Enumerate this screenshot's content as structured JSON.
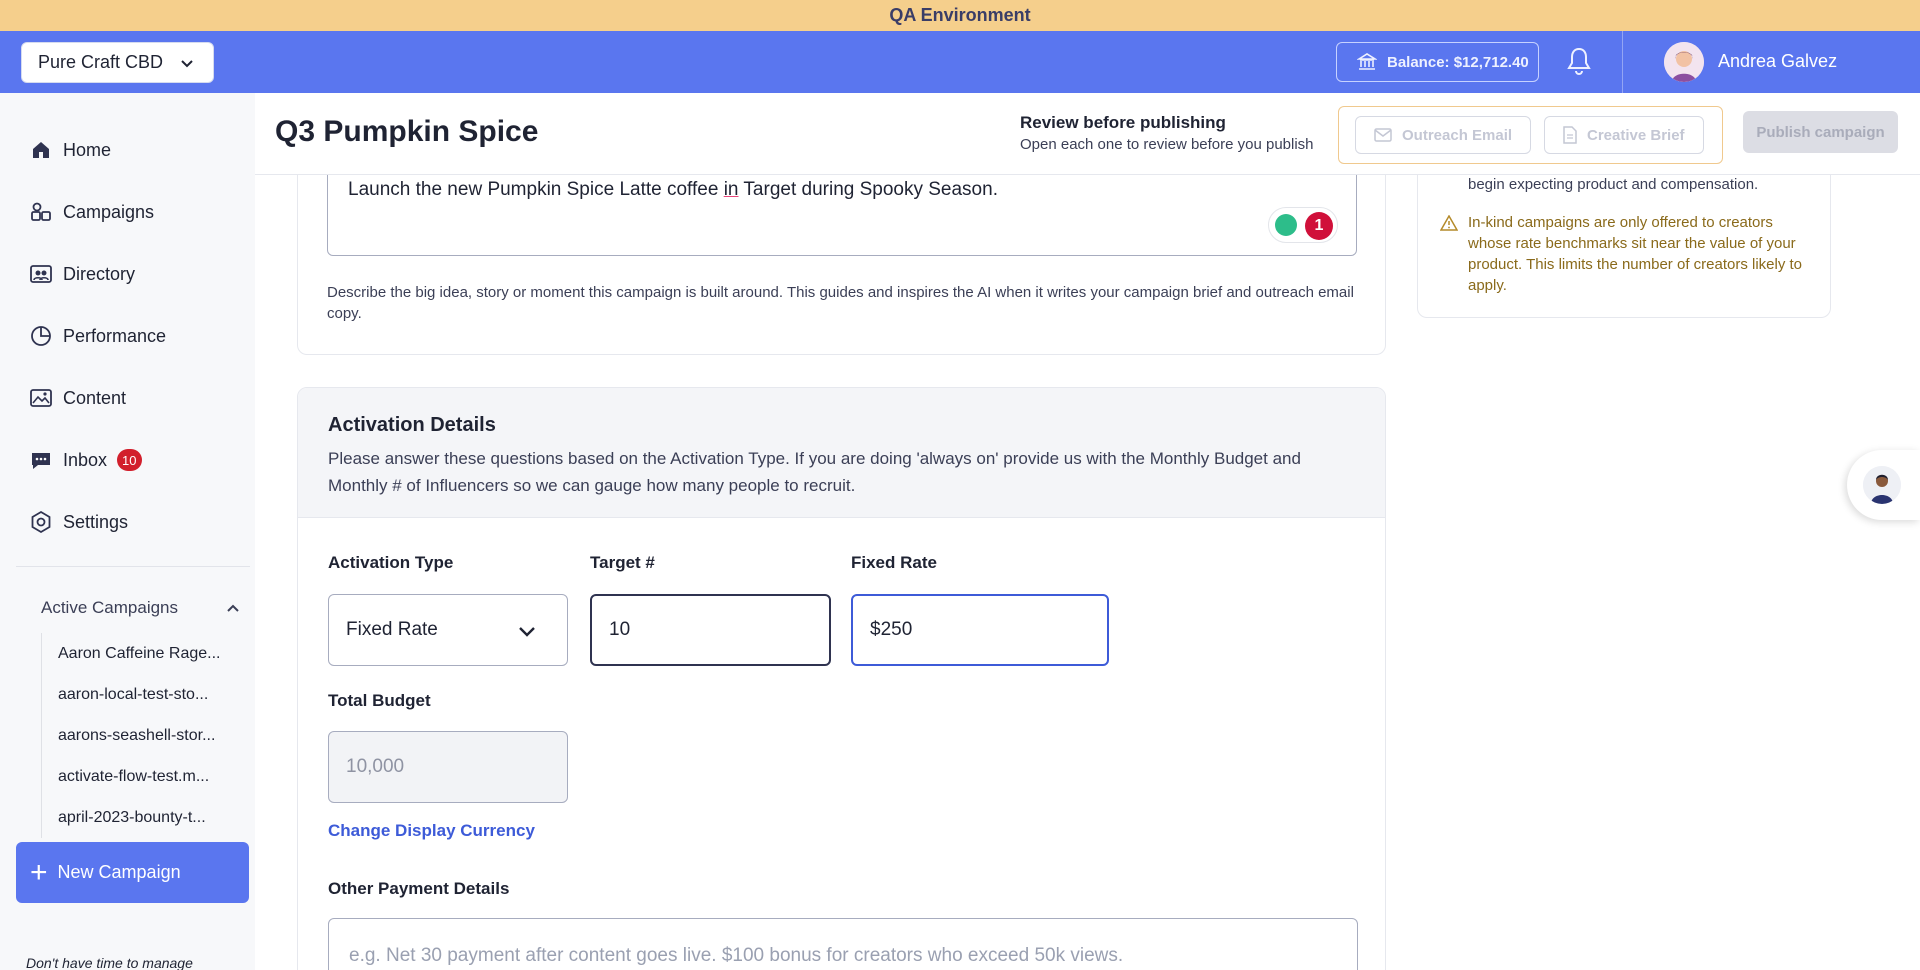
{
  "qa_banner": "QA Environment",
  "topbar": {
    "brand": "Pure Craft CBD",
    "balance": "Balance: $12,712.40",
    "user_name": "Andrea Galvez"
  },
  "sidebar": {
    "items": [
      {
        "label": "Home",
        "icon": "home-icon"
      },
      {
        "label": "Campaigns",
        "icon": "campaigns-icon"
      },
      {
        "label": "Directory",
        "icon": "directory-icon"
      },
      {
        "label": "Performance",
        "icon": "performance-icon"
      },
      {
        "label": "Content",
        "icon": "content-icon"
      },
      {
        "label": "Inbox",
        "icon": "inbox-icon",
        "badge": "10"
      },
      {
        "label": "Settings",
        "icon": "settings-icon"
      }
    ],
    "active_campaigns_label": "Active Campaigns",
    "campaigns": [
      "Aaron Caffeine Rage...",
      "aaron-local-test-sto...",
      "aarons-seashell-stor...",
      "activate-flow-test.m...",
      "april-2023-bounty-t..."
    ],
    "new_campaign_label": "New Campaign",
    "footer_text": "Don't have time to manage"
  },
  "header": {
    "title": "Q3 Pumpkin Spice",
    "review_title": "Review before publishing",
    "review_subtitle": "Open each one to review before you publish",
    "outreach_email_label": "Outreach Email",
    "creative_brief_label": "Creative Brief",
    "publish_label": "Publish campaign"
  },
  "concept": {
    "text_before": "Launch the new Pumpkin Spice Latte coffee ",
    "text_underlined": "in",
    "text_after": " Target during Spooky Season.",
    "grammar_count": "1",
    "description": "Describe the big idea, story or moment this campaign is built around. This guides and inspires the AI when it writes your campaign brief and outreach email copy."
  },
  "right_panel": {
    "line1": "begin expecting product and compensation.",
    "warning": "In-kind campaigns are only offered to creators whose rate benchmarks sit near the value of your product. This limits the number of creators likely to apply."
  },
  "activation": {
    "title": "Activation Details",
    "description": "Please answer these questions based on the Activation Type. If you are doing 'always on' provide us with the Monthly Budget and Monthly # of Influencers so we can gauge how many people to recruit.",
    "activation_type_label": "Activation Type",
    "activation_type_value": "Fixed Rate",
    "target_label": "Target #",
    "target_value": "10",
    "fixed_rate_label": "Fixed Rate",
    "fixed_rate_value": "$250",
    "total_budget_label": "Total Budget",
    "total_budget_value": "10,000",
    "change_currency_label": "Change Display Currency",
    "other_payment_label": "Other Payment Details",
    "other_payment_placeholder": "e.g. Net 30 payment after content goes live. $100 bonus for creators who exceed 50k views."
  },
  "colors": {
    "primary": "#5a76ef",
    "qa_banner": "#f5cf8c",
    "badge": "#d21f2c",
    "warning_text": "#8a6a1b"
  }
}
